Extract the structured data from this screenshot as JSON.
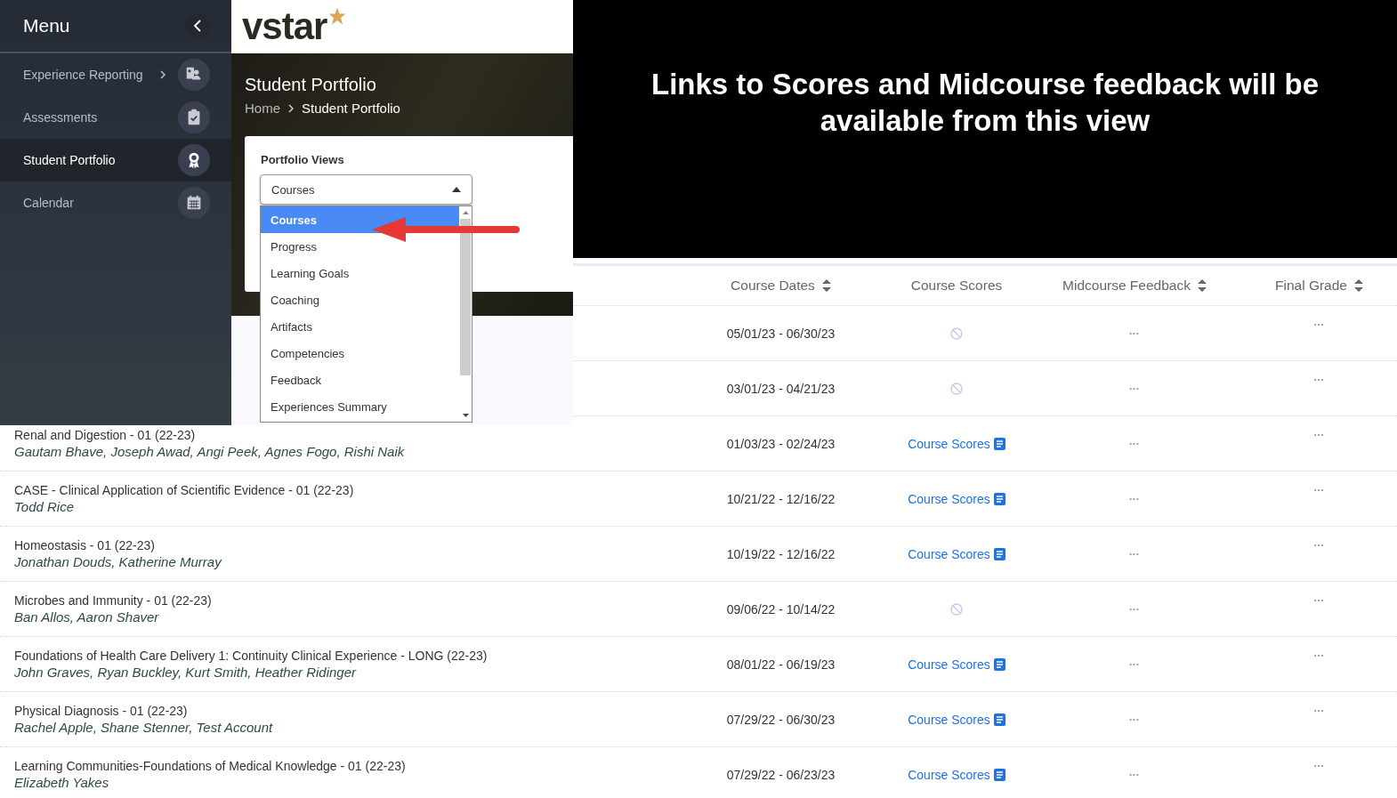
{
  "sidebar": {
    "title": "Menu",
    "items": [
      {
        "label": "Experience Reporting",
        "has_submenu": true,
        "selected": false
      },
      {
        "label": "Assessments",
        "has_submenu": false,
        "selected": false
      },
      {
        "label": "Student Portfolio",
        "has_submenu": false,
        "selected": true
      },
      {
        "label": "Calendar",
        "has_submenu": false,
        "selected": false
      }
    ]
  },
  "logo": "vstar",
  "header": {
    "title": "Student Portfolio",
    "breadcrumb": [
      "Home",
      "Student Portfolio"
    ]
  },
  "portfolio_views": {
    "label": "Portfolio Views",
    "value": "Courses",
    "expanded": true,
    "options": [
      {
        "label": "Courses",
        "selected": true
      },
      {
        "label": "Progress",
        "selected": false
      },
      {
        "label": "Learning Goals",
        "selected": false
      },
      {
        "label": "Coaching",
        "selected": false
      },
      {
        "label": "Artifacts",
        "selected": false
      },
      {
        "label": "Competencies",
        "selected": false
      },
      {
        "label": "Feedback",
        "selected": false
      },
      {
        "label": "Experiences Summary",
        "selected": false
      }
    ]
  },
  "banner": "Links to Scores and Midcourse feedback will be available from this view",
  "table": {
    "columns": [
      {
        "label": "Course Dates",
        "sortable": true
      },
      {
        "label": "Course Scores",
        "sortable": false
      },
      {
        "label": "Midcourse Feedback",
        "sortable": true
      },
      {
        "label": "Final Grade",
        "sortable": true
      }
    ],
    "rows": [
      {
        "dates": "05/01/23 - 06/30/23",
        "scores": {
          "kind": "none"
        },
        "midcourse": "•••",
        "final": "•••"
      },
      {
        "dates": "03/01/23 - 04/21/23",
        "scores": {
          "kind": "none"
        },
        "midcourse": "•••",
        "final": "•••"
      },
      {
        "course": "Renal and Digestion - 01 (22-23)",
        "people": "Gautam Bhave, Joseph Awad, Angi Peek, Agnes Fogo, Rishi Naik",
        "dates": "01/03/23 - 02/24/23",
        "scores": {
          "kind": "link",
          "label": "Course Scores"
        },
        "midcourse": "•••",
        "final": "•••"
      },
      {
        "course": "CASE - Clinical Application of Scientific Evidence - 01 (22-23)",
        "people": "Todd Rice",
        "dates": "10/21/22 - 12/16/22",
        "scores": {
          "kind": "link",
          "label": "Course Scores"
        },
        "midcourse": "•••",
        "final": "•••"
      },
      {
        "course": "Homeostasis - 01 (22-23)",
        "people": "Jonathan Douds, Katherine Murray",
        "dates": "10/19/22 - 12/16/22",
        "scores": {
          "kind": "link",
          "label": "Course Scores"
        },
        "midcourse": "•••",
        "final": "•••"
      },
      {
        "course": "Microbes and Immunity - 01 (22-23)",
        "people": "Ban Allos, Aaron Shaver",
        "dates": "09/06/22 - 10/14/22",
        "scores": {
          "kind": "none"
        },
        "midcourse": "•••",
        "final": "•••"
      },
      {
        "course": "Foundations of Health Care Delivery 1: Continuity Clinical Experience - LONG (22-23)",
        "people": "John Graves, Ryan Buckley, Kurt Smith, Heather Ridinger",
        "dates": "08/01/22 - 06/19/23",
        "scores": {
          "kind": "link",
          "label": "Course Scores"
        },
        "midcourse": "•••",
        "final": "•••"
      },
      {
        "course": "Physical Diagnosis - 01 (22-23)",
        "people": "Rachel Apple, Shane Stenner, Test Account",
        "dates": "07/29/22 - 06/30/23",
        "scores": {
          "kind": "link",
          "label": "Course Scores"
        },
        "midcourse": "•••",
        "final": "•••"
      },
      {
        "course": "Learning Communities-Foundations of Medical Knowledge - 01 (22-23)",
        "people": "Elizabeth Yakes",
        "dates": "07/29/22 - 06/23/23",
        "scores": {
          "kind": "link",
          "label": "Course Scores"
        },
        "midcourse": "•••",
        "final": "•••"
      }
    ]
  }
}
